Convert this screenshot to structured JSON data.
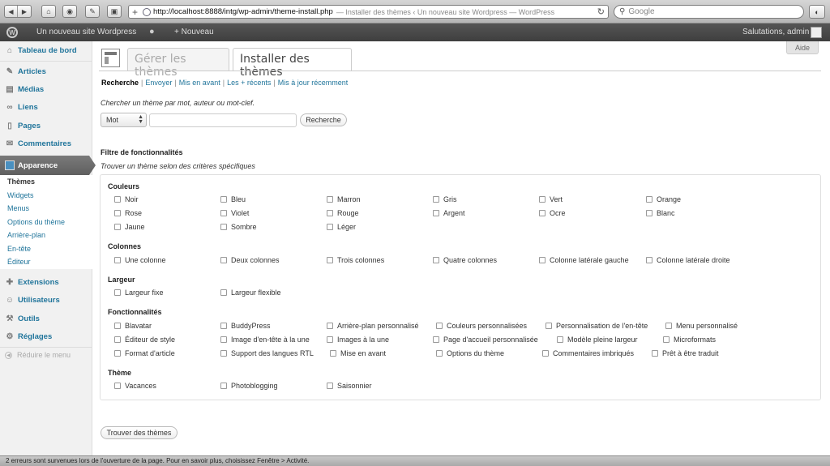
{
  "browser": {
    "url": "http://localhost:8888/intg/wp-admin/theme-install.php",
    "page_title": "— Installer des thèmes ‹ Un nouveau site Wordpress — WordPress",
    "search_placeholder": "Google",
    "status_text": "2 erreurs sont survenues lors de l'ouverture de la page. Pour en savoir plus, choisissez Fenêtre > Activité."
  },
  "adminbar": {
    "site_name": "Un nouveau site Wordpress",
    "new_label": "+ Nouveau",
    "greeting": "Salutations, admin"
  },
  "help_label": "Aide",
  "sidebar": {
    "items": [
      {
        "label": "Tableau de bord",
        "icon": "dashboard-icon"
      },
      {
        "label": "Articles",
        "icon": "pin-icon"
      },
      {
        "label": "Médias",
        "icon": "media-icon"
      },
      {
        "label": "Liens",
        "icon": "link-icon"
      },
      {
        "label": "Pages",
        "icon": "page-icon"
      },
      {
        "label": "Commentaires",
        "icon": "comment-icon"
      },
      {
        "label": "Apparence",
        "icon": "appearance-icon"
      },
      {
        "label": "Extensions",
        "icon": "plugin-icon"
      },
      {
        "label": "Utilisateurs",
        "icon": "users-icon"
      },
      {
        "label": "Outils",
        "icon": "tools-icon"
      },
      {
        "label": "Réglages",
        "icon": "settings-icon"
      }
    ],
    "submenu": [
      "Thèmes",
      "Widgets",
      "Menus",
      "Options du thème",
      "Arrière-plan",
      "En-tête",
      "Éditeur"
    ],
    "collapse_label": "Réduire le menu"
  },
  "tabs": [
    "Gérer les thèmes",
    "Installer des thèmes"
  ],
  "subsub": [
    "Recherche",
    "Envoyer",
    "Mis en avant",
    "Les + récents",
    "Mis à jour récemment"
  ],
  "search": {
    "description": "Chercher un thème par mot, auteur ou mot-clef.",
    "select_value": "Mot",
    "button_label": "Recherche"
  },
  "features": {
    "title": "Filtre de fonctionnalités",
    "description": "Trouver un thème selon des critères spécifiques",
    "groups": [
      {
        "title": "Couleurs",
        "items": [
          "Noir",
          "Bleu",
          "Marron",
          "Gris",
          "Vert",
          "Orange",
          "Rose",
          "Violet",
          "Rouge",
          "Argent",
          "Ocre",
          "Blanc",
          "Jaune",
          "Sombre",
          "Léger"
        ]
      },
      {
        "title": "Colonnes",
        "items": [
          "Une colonne",
          "Deux colonnes",
          "Trois colonnes",
          "Quatre colonnes",
          "Colonne latérale gauche",
          "Colonne latérale droite"
        ]
      },
      {
        "title": "Largeur",
        "items": [
          "Largeur fixe",
          "Largeur flexible"
        ]
      },
      {
        "title": "Fonctionnalités",
        "items": [
          "Blavatar",
          "BuddyPress",
          "Arrière-plan personnalisé",
          "Couleurs personnalisées",
          "Personnalisation de l'en-tête",
          "Menu personnalisé",
          "Éditeur de style",
          "Image d'en-tête à la une",
          "Images à la une",
          "Page d'accueil personnalisée",
          "Modèle pleine largeur",
          "Microformats",
          "Format d'article",
          "Support des langues RTL",
          "Mise en avant",
          "Options du thème",
          "Commentaires imbriqués",
          "Prêt à être traduit"
        ]
      },
      {
        "title": "Thème",
        "items": [
          "Vacances",
          "Photoblogging",
          "Saisonnier"
        ]
      }
    ],
    "submit_label": "Trouver des thèmes"
  }
}
